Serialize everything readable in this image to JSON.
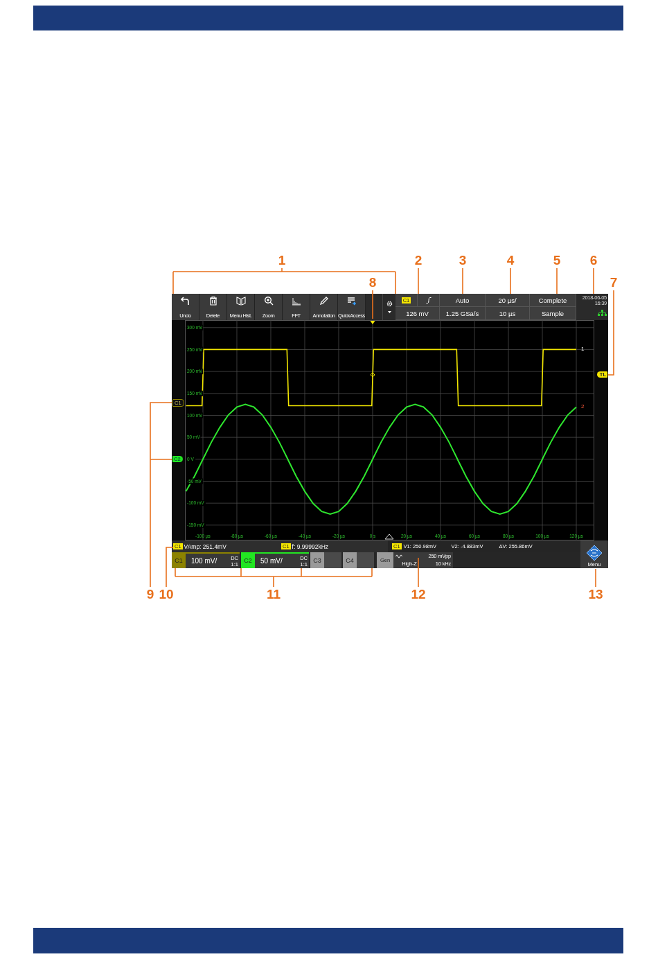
{
  "callouts": [
    "1",
    "2",
    "3",
    "4",
    "5",
    "6",
    "7",
    "8",
    "9",
    "10",
    "11",
    "12",
    "13"
  ],
  "toolbar": {
    "tools": [
      {
        "label": "Undo"
      },
      {
        "label": "Delete"
      },
      {
        "label": "Menu Hist."
      },
      {
        "label": "Zoom"
      },
      {
        "label": "FFT"
      },
      {
        "label": "Annotation"
      },
      {
        "label": "QuickAccess"
      }
    ]
  },
  "trigger": {
    "source": "C1",
    "level": "126 mV",
    "mode": "Auto",
    "sample_rate": "1.25 GSa/s"
  },
  "timebase": {
    "scale": "20 µs/",
    "position": "10 µs"
  },
  "acquisition": {
    "state": "Complete",
    "mode": "Sample"
  },
  "status": {
    "date": "2018-06-05",
    "time": "16:39"
  },
  "plot": {
    "trigger_level_tag": "TL",
    "trace_labels": [
      "1",
      "2"
    ],
    "chart_data": {
      "type": "line",
      "grid": true,
      "x": [
        -110,
        -105,
        -100.5,
        -99.5,
        -95,
        -90,
        -85,
        -80,
        -75,
        -70,
        -65,
        -60,
        -55,
        -50.5,
        -49.5,
        -45,
        -40,
        -35,
        -30,
        -25,
        -20,
        -15,
        -10,
        -5,
        -0.5,
        0.5,
        5,
        10,
        15,
        20,
        25,
        30,
        35,
        40,
        45,
        49.5,
        50.5,
        55,
        60,
        65,
        70,
        75,
        80,
        85,
        90,
        95,
        99.5,
        100.5,
        105,
        110,
        115,
        120
      ],
      "series": [
        {
          "name": "C1",
          "color": "#f2e600",
          "values": [
            122,
            122,
            122,
            250,
            250,
            250,
            250,
            250,
            250,
            250,
            250,
            250,
            250,
            250,
            122,
            122,
            122,
            122,
            122,
            122,
            122,
            122,
            122,
            122,
            122,
            250,
            250,
            250,
            250,
            250,
            250,
            250,
            250,
            250,
            250,
            250,
            122,
            122,
            122,
            122,
            122,
            122,
            122,
            122,
            122,
            122,
            122,
            250,
            250,
            250,
            250,
            250
          ]
        },
        {
          "name": "C2",
          "color": "#2ee62e",
          "values": [
            -73,
            -39,
            -4,
            4,
            39,
            73,
            101,
            119,
            125,
            119,
            101,
            73,
            39,
            4,
            -4,
            -39,
            -73,
            -101,
            -119,
            -125,
            -119,
            -101,
            -73,
            -39,
            -4,
            4,
            39,
            73,
            101,
            119,
            125,
            119,
            101,
            73,
            39,
            4,
            -4,
            -39,
            -73,
            -101,
            -119,
            -125,
            -119,
            -101,
            -73,
            -39,
            -4,
            4,
            39,
            73,
            101,
            119
          ]
        }
      ],
      "xlim": [
        -110.6,
        130.6
      ],
      "ylim": [
        -185,
        317
      ],
      "xticks": [
        {
          "value": -100,
          "label": "-100 µs"
        },
        {
          "value": -80,
          "label": "-80 µs"
        },
        {
          "value": -60,
          "label": "-60 µs"
        },
        {
          "value": -40,
          "label": "-40 µs"
        },
        {
          "value": -20,
          "label": "-20 µs"
        },
        {
          "value": 0,
          "label": "0 s"
        },
        {
          "value": 20,
          "label": "20 µs"
        },
        {
          "value": 40,
          "label": "40 µs"
        },
        {
          "value": 60,
          "label": "60 µs"
        },
        {
          "value": 80,
          "label": "80 µs"
        },
        {
          "value": 100,
          "label": "100 µs"
        },
        {
          "value": 120,
          "label": "120 µs"
        }
      ],
      "yticks": [
        {
          "value": 300,
          "label": "300 mV"
        },
        {
          "value": 250,
          "label": "250 mV"
        },
        {
          "value": 200,
          "label": "200 mV"
        },
        {
          "value": 150,
          "label": "150 mV"
        },
        {
          "value": 100,
          "label": "100 mV"
        },
        {
          "value": 50,
          "label": "50 mV"
        },
        {
          "value": 0,
          "label": "0 V"
        },
        {
          "value": -50,
          "label": "-50 mV"
        },
        {
          "value": -100,
          "label": "-100 mV"
        },
        {
          "value": -150,
          "label": "-150 mV"
        }
      ]
    }
  },
  "measurements": [
    {
      "source": "C1",
      "text": "VAmp: 251.4mV"
    },
    {
      "source": "C1",
      "text": "f: 9.99992kHz"
    }
  ],
  "cursors": {
    "source": "C1",
    "values": [
      "V1: 250.98mV",
      "V2: -4.883mV",
      "ΔV: 255.86mV"
    ]
  },
  "channels": [
    {
      "label": "C1",
      "on": true,
      "color": "#8c8200",
      "scale": "100 mV/",
      "coupling": "DC",
      "probe": "1:1"
    },
    {
      "label": "C2",
      "on": true,
      "color": "#22e622",
      "scale": "50 mV/",
      "coupling": "DC",
      "probe": "1:1"
    },
    {
      "label": "C3",
      "on": false
    },
    {
      "label": "C4",
      "on": false
    }
  ],
  "generator": {
    "label": "Gen",
    "amplitude": "250 mVpp",
    "impedance": "High-Z",
    "frequency": "10 kHz"
  },
  "menu": {
    "label": "Menu"
  }
}
